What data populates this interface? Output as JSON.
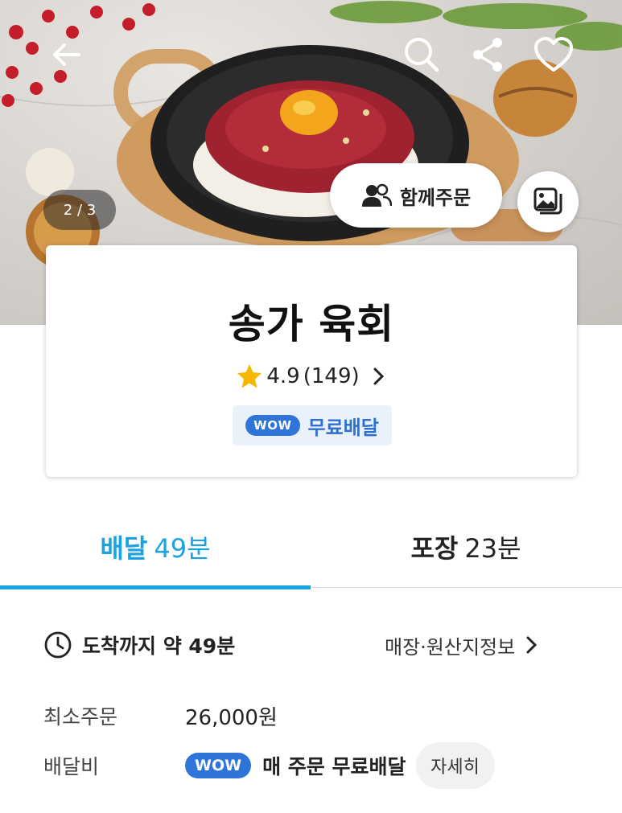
{
  "hero": {
    "image_counter": "2 / 3",
    "group_order_label": "함께주문",
    "icons": {
      "back": "arrow-left-icon",
      "search": "search-icon",
      "share": "share-icon",
      "favorite": "heart-icon",
      "group": "people-icon",
      "gallery": "gallery-icon"
    }
  },
  "store": {
    "name": "송가 육회",
    "rating": "4.9",
    "review_count": "(149)",
    "wow_badge": "WOW",
    "free_delivery": "무료배달"
  },
  "tabs": [
    {
      "label": "배달",
      "time": "49분",
      "active": true
    },
    {
      "label": "포장",
      "time": "23분",
      "active": false
    }
  ],
  "info": {
    "arrival_text": "도착까지 약 49분",
    "store_info_link": "매장·원산지정보",
    "min_order_label": "최소주문",
    "min_order_value": "26,000원",
    "fee_label": "배달비",
    "fee_wow": "WOW",
    "fee_text": "매 주문 무료배달",
    "detail_button": "자세히"
  },
  "colors": {
    "accent": "#19a3e0",
    "wow_blue": "#2f75d8",
    "badge_bg": "#e9f1fb",
    "star": "#f5b800"
  }
}
